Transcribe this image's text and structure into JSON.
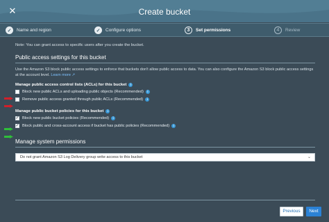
{
  "header": {
    "title": "Create bucket",
    "close_glyph": "✕"
  },
  "steps": [
    {
      "number": "✓",
      "label": "Name and region",
      "state": "done"
    },
    {
      "number": "✓",
      "label": "Configure options",
      "state": "done"
    },
    {
      "number": "3",
      "label": "Set permissions",
      "state": "active"
    },
    {
      "number": "4",
      "label": "Review",
      "state": "future"
    }
  ],
  "note": "Note: You can grant access to specific users after you create the bucket.",
  "public_access": {
    "heading": "Public access settings for this bucket",
    "description": "Use the Amazon S3 block public access settings to enforce that buckets don't allow public access to data. You can also configure the Amazon S3 block public access settings at the account level.",
    "learn_more": "Learn more ↗",
    "acl_heading": "Manage public access control lists (ACLs) for this bucket",
    "acl_options": [
      {
        "label": "Block new public ACLs and uploading public objects (Recommended)",
        "checked": false
      },
      {
        "label": "Remove public access granted through public ACLs (Recommended)",
        "checked": false
      }
    ],
    "policy_heading": "Manage public bucket policies for this bucket",
    "policy_options": [
      {
        "label": "Block new public bucket policies (Recommended)",
        "checked": true
      },
      {
        "label": "Block public and cross-account access if bucket has public policies (Recommended)",
        "checked": true
      }
    ]
  },
  "system_permissions": {
    "heading": "Manage system permissions",
    "select_value": "Do not grant Amazon S3 Log Delivery group write access to this bucket"
  },
  "footer": {
    "previous_label": "Previous",
    "next_label": "Next"
  },
  "colors": {
    "red_arrow": "#d0202a",
    "green_arrow": "#2fbf3a",
    "primary": "#2b82d6"
  },
  "icons": {
    "info": "info-icon",
    "check": "checkmark-icon"
  }
}
